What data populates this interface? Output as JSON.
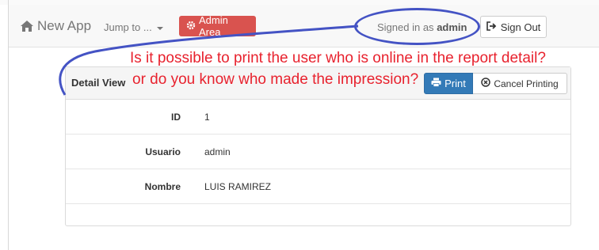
{
  "navbar": {
    "brand": "New App",
    "jump_label": "Jump to ...",
    "admin_label": "Admin Area",
    "signed_prefix": "Signed in as",
    "signed_user": "admin",
    "signout_label": "Sign Out"
  },
  "annotation": {
    "line1": "Is it possible to print the user who is online in the report detail?",
    "line2": "or do you know who made the impression?",
    "text_color": "#e8222e",
    "outline_color": "#4453c4"
  },
  "panel": {
    "title": "Detail View",
    "print_label": "Print",
    "cancel_label": "Cancel Printing",
    "rows": [
      {
        "label": "ID",
        "value": "1"
      },
      {
        "label": "Usuario",
        "value": "admin"
      },
      {
        "label": "Nombre",
        "value": "LUIS RAMIREZ"
      }
    ]
  },
  "colors": {
    "danger": "#d9534f",
    "primary": "#337ab7"
  },
  "icons": [
    "home-icon",
    "caret-down-icon",
    "gear-icon",
    "sign-out-icon",
    "print-icon",
    "cancel-circle-icon"
  ]
}
